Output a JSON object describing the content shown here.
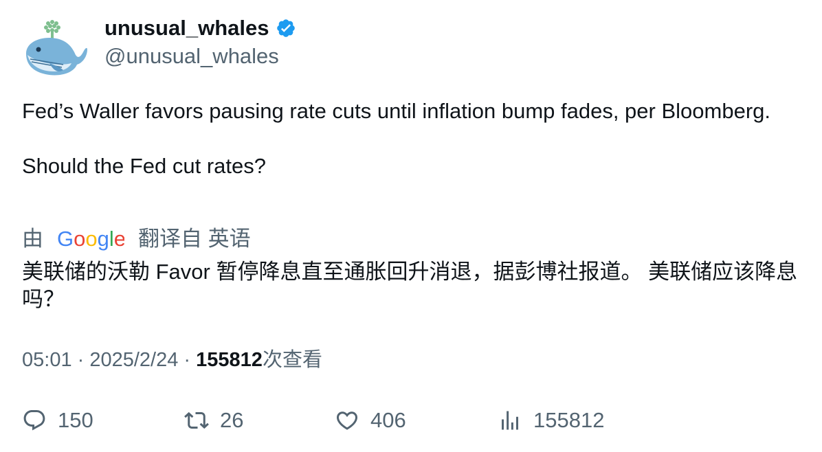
{
  "author": {
    "name": "unusual_whales",
    "handle": "@unusual_whales",
    "verified_color": "#1d9bf0"
  },
  "tweet": {
    "line1": "Fed’s Waller favors pausing rate cuts until inflation bump fades, per Bloomberg.",
    "line2": "Should the Fed cut rates?"
  },
  "translation": {
    "prefix": "由",
    "provider": "Google",
    "suffix": "翻译自 英语",
    "text": "美联储的沃勒 Favor 暂停降息直至通胀回升消退，据彭博社报道。 美联储应该降息吗？"
  },
  "meta": {
    "time": "05:01",
    "sep1": " · ",
    "date": "2025/2/24",
    "sep2": " · ",
    "views": "155812",
    "views_label": "次查看"
  },
  "actions": {
    "replies": "150",
    "retweets": "26",
    "likes": "406",
    "views": "155812"
  },
  "icons": {
    "reply": "reply-icon",
    "retweet": "retweet-icon",
    "like": "heart-icon",
    "analytics": "analytics-icon",
    "verified": "verified-badge-icon"
  }
}
